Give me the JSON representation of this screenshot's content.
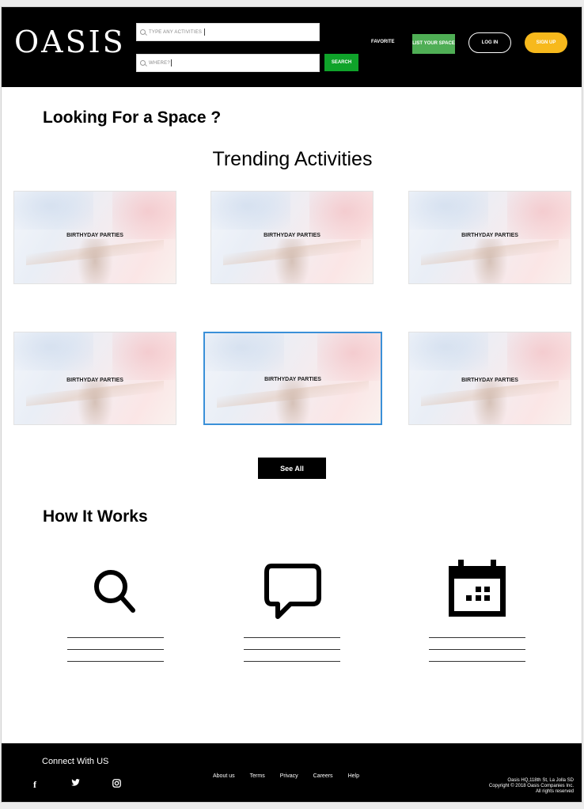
{
  "header": {
    "logo": "OASIS",
    "search_activities_placeholder": "TYPE ANY ACTIVITIES",
    "search_where_placeholder": "WHERE?",
    "search_button": "SEARCH",
    "favorite": "FAVORITE",
    "list_space": "LIST YOUR SPACE",
    "login": "LOG IN",
    "signup": "SIGN UP"
  },
  "main": {
    "looking_title": "Looking For a Space ?",
    "trending_title": "Trending Activities",
    "cards": [
      {
        "label": "BIRTHYDAY PARTIES"
      },
      {
        "label": "BIRTHYDAY PARTIES"
      },
      {
        "label": "BIRTHYDAY PARTIES"
      },
      {
        "label": "BIRTHYDAY PARTIES"
      },
      {
        "label": "BIRTHYDAY PARTIES"
      },
      {
        "label": "BIRTHYDAY PARTIES"
      }
    ],
    "see_all": "See All",
    "how_title": "How It Works",
    "steps": [
      {
        "icon": "search-icon"
      },
      {
        "icon": "chat-bubble-icon"
      },
      {
        "icon": "calendar-icon"
      }
    ]
  },
  "footer": {
    "connect": "Connect With US",
    "social": [
      "facebook-icon",
      "twitter-icon",
      "instagram-icon"
    ],
    "links": [
      "About us",
      "Terms",
      "Privacy",
      "Careers",
      "Help"
    ],
    "address_line1": "Oasis HQ,118th St, La Jolla SD",
    "address_line2": "Copyright © 2018 Oasis Companies Inc.",
    "address_line3": "All rights reserved"
  },
  "colors": {
    "header_bg": "#000000",
    "search_green": "#0fa32a",
    "list_green": "#4fae55",
    "signup_yellow": "#f7b91c",
    "selected_border": "#3a90d8"
  }
}
